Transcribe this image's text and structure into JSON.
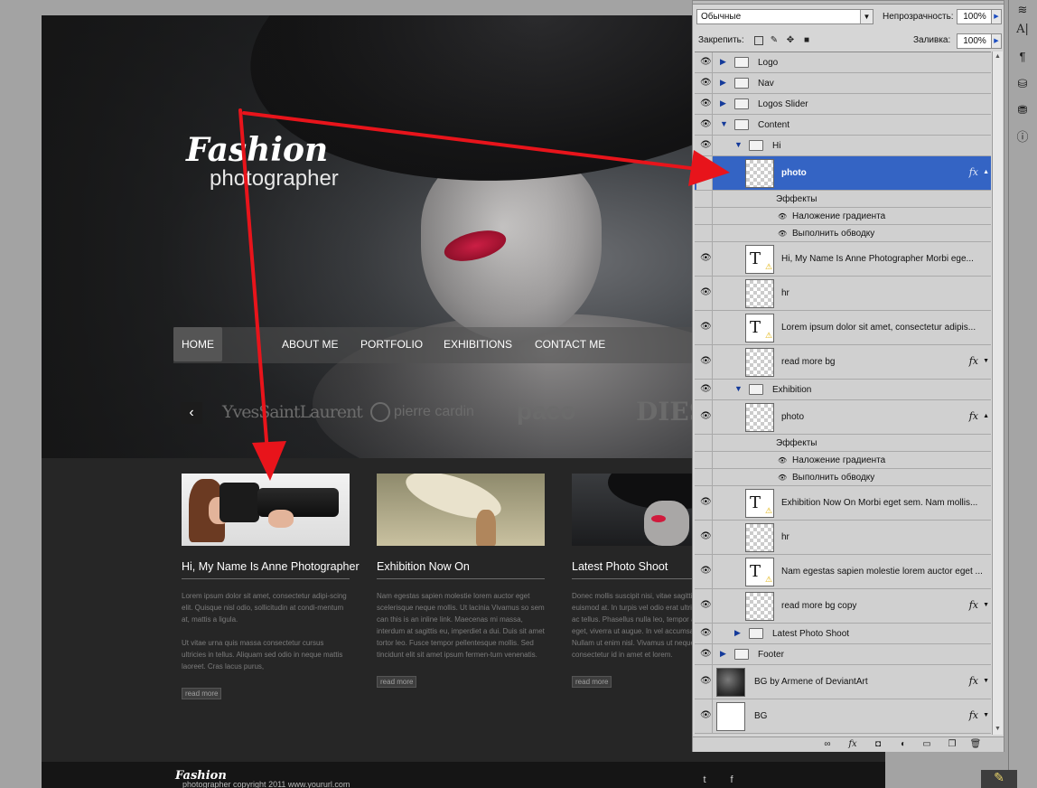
{
  "site": {
    "logo_title": "Fashion",
    "logo_sub": "photographer",
    "nav": [
      {
        "label": "HOME"
      },
      {
        "label": "ABOUT ME"
      },
      {
        "label": "PORTFOLIO"
      },
      {
        "label": "EXHIBITIONS"
      },
      {
        "label": "CONTACT ME"
      }
    ],
    "slider_arrow": "‹",
    "brands": [
      "YvesSaintLaurent",
      "pierre cardin",
      "paco",
      "DIESEL"
    ],
    "cards": [
      {
        "title": "Hi, My Name Is Anne Photographer",
        "p1": "Lorem ipsum dolor sit amet, consectetur adipi-scing elit. Quisque nisl odio, sollicitudin at condi-mentum at, mattis a ligula.",
        "p2": "Ut vitae urna quis massa consectetur cursus ultricies in tellus. Aliquam sed odio in neque mattis laoreet. Cras lacus purus,",
        "read_more": "read more"
      },
      {
        "title": "Exhibition Now On",
        "p1": "Nam egestas sapien molestie lorem auctor eget scelerisque neque mollis. Ut lacinia Vivamus so sem can this is an inline link. Maecenas mi massa, interdum at sagittis eu, imperdiet a dui. Duis sit amet tortor leo. Fusce tempor pellentesque mollis. Sed tincidunt elit sit amet ipsum fermen-tum venenatis.",
        "p2": "",
        "read_more": "read more"
      },
      {
        "title": "Latest Photo Shoot",
        "p1": "Donec mollis suscipit nisi, vitae sagittis sem euismod at. In turpis vel odio erat ultrices. Ut tate at ac tellus. Phasellus nulla leo, tempor amet congue eget, viverra ut augue. In vel accumsan consequat. Nullam ut enim nisl. Vivamus ut neque aliquam consectetur id in amet et lorem.",
        "p2": "",
        "read_more": "read more"
      }
    ],
    "footer_logo": "Fashion",
    "footer_copy": "photographer  copyright 2011 www.yoururl.com",
    "social": [
      "t",
      "f"
    ]
  },
  "panel": {
    "blend_mode": "Обычные",
    "opacity_label": "Непрозрачность:",
    "opacity_value": "100%",
    "lock_label": "Закрепить:",
    "fill_label": "Заливка:",
    "fill_value": "100%",
    "layers": [
      {
        "name": "Logo"
      },
      {
        "name": "Nav"
      },
      {
        "name": "Logos Slider"
      },
      {
        "name": "Content"
      },
      {
        "name": "Hi"
      },
      {
        "name": "photo"
      },
      {
        "name": "Эффекты"
      },
      {
        "name": "Наложение градиента"
      },
      {
        "name": "Выполнить обводку"
      },
      {
        "name": "Hi, My Name Is Anne Photographer Morbi ege..."
      },
      {
        "name": "hr"
      },
      {
        "name": "Lorem ipsum dolor sit amet, consectetur adipis..."
      },
      {
        "name": "read more bg"
      },
      {
        "name": "Exhibition"
      },
      {
        "name": "photo"
      },
      {
        "name": "Эффекты"
      },
      {
        "name": "Наложение градиента"
      },
      {
        "name": "Выполнить обводку"
      },
      {
        "name": "Exhibition Now On Morbi eget sem. Nam mollis..."
      },
      {
        "name": "hr"
      },
      {
        "name": "Nam egestas sapien molestie lorem auctor eget ..."
      },
      {
        "name": "read more bg copy"
      },
      {
        "name": "Latest Photo Shoot"
      },
      {
        "name": "Footer"
      },
      {
        "name": "BG by Armene of DeviantArt"
      },
      {
        "name": "BG"
      }
    ],
    "fx": "fx",
    "text_thumb": "T"
  },
  "colors": {
    "selection": "#3464c4",
    "arrow": "#e8141b"
  }
}
